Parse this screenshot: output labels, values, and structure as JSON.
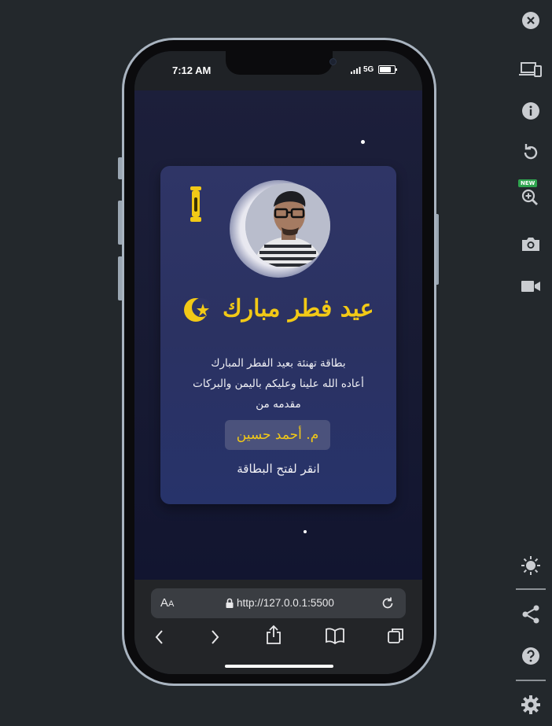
{
  "status": {
    "time": "7:12 AM",
    "network": "5G",
    "battery_level": 0.8
  },
  "card": {
    "title": "عيد فطر مبارك",
    "message_line1": "بطاقة تهنئة بعيد الفطر المبارك",
    "message_line2": "أعاده الله علينا وعليكم باليمن والبركات",
    "message_line3": "مقدمه من",
    "sender_name": "م. أحمد حسين",
    "open_label": "انقر لفتح البطاقة"
  },
  "browser": {
    "text_size_label": "A",
    "text_size_small": "A",
    "url": "http://127.0.0.1:5500"
  },
  "colors": {
    "accent": "#f2c916",
    "card_bg": "#2f3566",
    "page_bg": "#171a32"
  },
  "toolbar_badge": "NEW"
}
